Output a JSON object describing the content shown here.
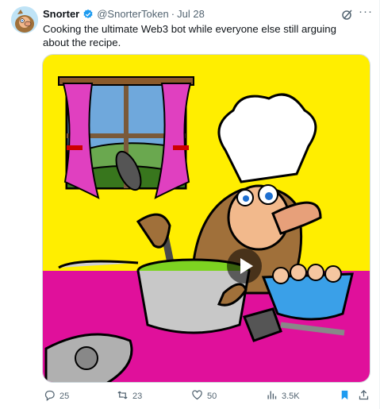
{
  "tweet": {
    "display_name": "Snorter",
    "handle": "@SnorterToken",
    "separator": "·",
    "date": "Jul 28",
    "more_label": "···",
    "text": "Cooking the ultimate Web3 bot while everyone else still arguing about the recipe."
  },
  "actions": {
    "replies": "25",
    "reposts": "23",
    "likes": "50",
    "views": "3.5K"
  },
  "colors": {
    "verified": "#1d9bf0",
    "bookmark": "#1d9bf0",
    "bg_yellow": "#ffee00",
    "table_magenta": "#e0109b",
    "action_gray": "#536471"
  },
  "icons": [
    "verified-badge-icon",
    "grok-icon",
    "more-icon",
    "reply-icon",
    "repost-icon",
    "like-icon",
    "views-icon",
    "bookmark-icon",
    "share-icon",
    "play-icon"
  ]
}
